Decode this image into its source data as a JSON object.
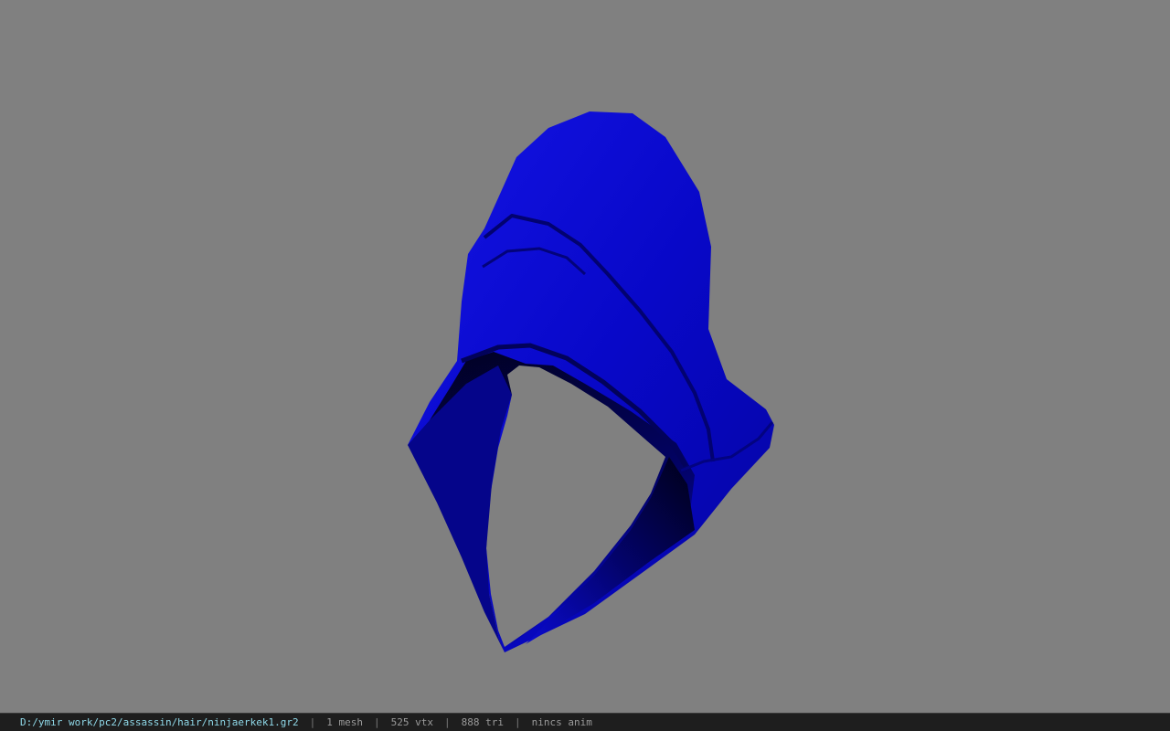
{
  "viewport": {
    "background_color": "#808080",
    "model": {
      "object": "hood-mesh",
      "color": "#0a0ad0",
      "shadow_color": "#000030"
    }
  },
  "status_bar": {
    "path": "D:/ymir work/pc2/assassin/hair/ninjaerkek1.gr2",
    "separator": "|",
    "mesh": "1 mesh",
    "vertices": "525 vtx",
    "triangles": "888 tri",
    "animation": "nincs anim",
    "path_color": "#8fd8e8"
  }
}
